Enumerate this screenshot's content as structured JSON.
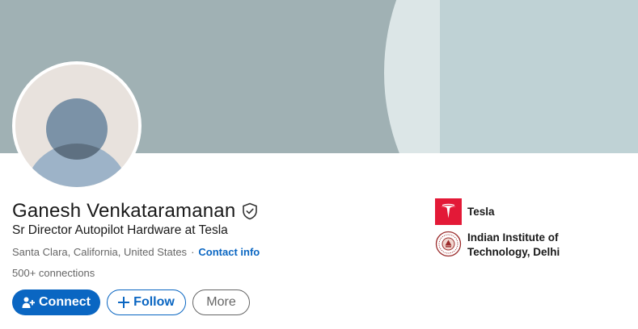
{
  "profile": {
    "name": "Ganesh Venkataramanan",
    "headline": "Sr Director Autopilot Hardware at Tesla",
    "location": "Santa Clara, California, United States",
    "separator": "·",
    "contact_info": "Contact info",
    "connections": "500+ connections"
  },
  "actions": {
    "connect": "Connect",
    "follow": "Follow",
    "more": "More"
  },
  "organizations": [
    {
      "name": "Tesla",
      "logo": "tesla-logo"
    },
    {
      "name": "Indian Institute of Technology, Delhi",
      "logo": "iit-delhi-seal"
    }
  ],
  "colors": {
    "accent": "#0a66c2",
    "banner": "#a0b1b4",
    "tesla_red": "#e31937"
  },
  "icons": {
    "verified": "verified-shield-icon",
    "connect": "add-person-icon",
    "follow": "plus-icon"
  }
}
